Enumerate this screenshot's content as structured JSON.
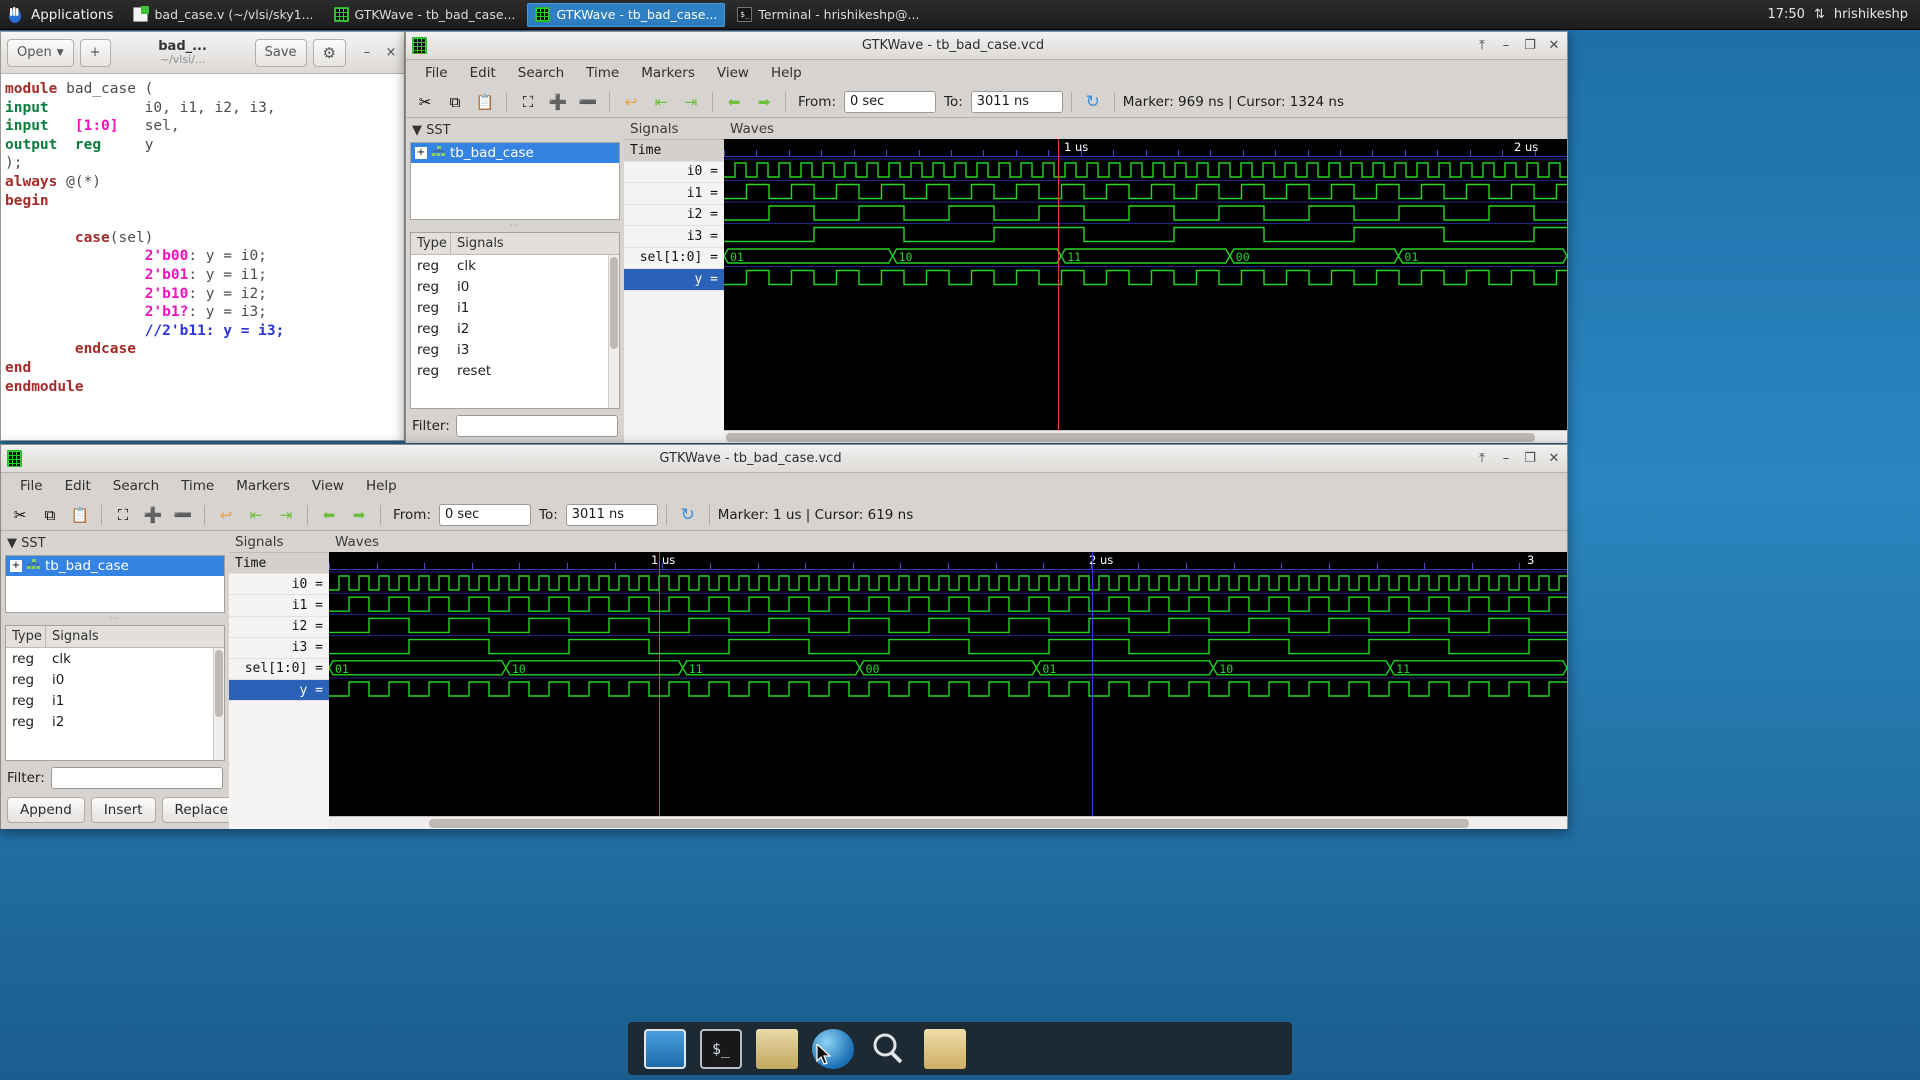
{
  "topbar": {
    "apps_label": "Applications",
    "tasks": [
      {
        "label": "bad_case.v (~/vlsi/sky1...",
        "icon": "gedit-icon",
        "active": false
      },
      {
        "label": "GTKWave - tb_bad_case...",
        "icon": "gtkwave-icon",
        "active": false
      },
      {
        "label": "GTKWave - tb_bad_case...",
        "icon": "gtkwave-icon",
        "active": true
      },
      {
        "label": "Terminal - hrishikeshp@...",
        "icon": "terminal-icon",
        "active": false
      }
    ],
    "clock": "17:50",
    "network_icon": "network-updown-icon",
    "user": "hrishikeshp"
  },
  "editor": {
    "open_label": "Open",
    "new_label": "+",
    "file_name": "bad_...",
    "file_path": "~/vlsi/...",
    "save_label": "Save",
    "menu_icon": "gear-icon",
    "minimize_label": "–",
    "close_label": "×",
    "code_lines": [
      [
        {
          "t": "module ",
          "c": "kw"
        },
        {
          "t": "bad_case (",
          "c": "pln"
        }
      ],
      [
        {
          "t": "input",
          "c": "kw2"
        },
        {
          "t": "           i0, i1, i2, i3,",
          "c": "pln"
        }
      ],
      [
        {
          "t": "input",
          "c": "kw2"
        },
        {
          "t": "   ",
          "c": "pln"
        },
        {
          "t": "[1:0]",
          "c": "lit"
        },
        {
          "t": "   sel,",
          "c": "pln"
        }
      ],
      [
        {
          "t": "output",
          "c": "kw2"
        },
        {
          "t": "  ",
          "c": "pln"
        },
        {
          "t": "reg",
          "c": "kw2"
        },
        {
          "t": "     y",
          "c": "pln"
        }
      ],
      [
        {
          "t": ");",
          "c": "pln"
        }
      ],
      [
        {
          "t": "always",
          "c": "kw"
        },
        {
          "t": " @(*)",
          "c": "pln"
        }
      ],
      [
        {
          "t": "begin",
          "c": "kw"
        }
      ],
      [
        {
          "t": "",
          "c": "pln"
        }
      ],
      [
        {
          "t": "        ",
          "c": "pln"
        },
        {
          "t": "case",
          "c": "kw"
        },
        {
          "t": "(sel)",
          "c": "pln"
        }
      ],
      [
        {
          "t": "                ",
          "c": "pln"
        },
        {
          "t": "2'b00",
          "c": "lit"
        },
        {
          "t": ": y = i0;",
          "c": "pln"
        }
      ],
      [
        {
          "t": "                ",
          "c": "pln"
        },
        {
          "t": "2'b01",
          "c": "lit"
        },
        {
          "t": ": y = i1;",
          "c": "pln"
        }
      ],
      [
        {
          "t": "                ",
          "c": "pln"
        },
        {
          "t": "2'b10",
          "c": "lit"
        },
        {
          "t": ": y = i2;",
          "c": "pln"
        }
      ],
      [
        {
          "t": "                ",
          "c": "pln"
        },
        {
          "t": "2'b1?",
          "c": "lit"
        },
        {
          "t": ": y = i3;",
          "c": "pln"
        }
      ],
      [
        {
          "t": "                ",
          "c": "pln"
        },
        {
          "t": "//2'b11: y = i3;",
          "c": "cmt"
        }
      ],
      [
        {
          "t": "        ",
          "c": "pln"
        },
        {
          "t": "endcase",
          "c": "kw"
        }
      ],
      [
        {
          "t": "end",
          "c": "kw"
        }
      ],
      [
        {
          "t": "endmodule",
          "c": "kw"
        }
      ]
    ]
  },
  "gtkwave_top": {
    "title": "GTKWave - tb_bad_case.vcd",
    "app_icon": "gtkwave-icon",
    "window_buttons": {
      "restore": "⤒",
      "minimize": "–",
      "maximize": "❐",
      "close": "✕"
    },
    "menu": [
      "File",
      "Edit",
      "Search",
      "Time",
      "Markers",
      "View",
      "Help"
    ],
    "toolbar_icons": [
      "cut-icon",
      "copy-icon",
      "paste-icon",
      "zoom-fit-icon",
      "zoom-in-icon",
      "zoom-out-icon",
      "undo-icon",
      "goto-start-icon",
      "goto-end-icon",
      "back-icon",
      "forward-icon"
    ],
    "from_label": "From:",
    "from_value": "0 sec",
    "to_label": "To:",
    "to_value": "3011 ns",
    "reload_icon": "reload-icon",
    "status": "Marker: 969 ns  |  Cursor: 1324 ns",
    "sst_label": "SST",
    "tree_root": "tb_bad_case",
    "signals_header": {
      "type": "Type",
      "signals": "Signals"
    },
    "signal_rows": [
      {
        "type": "reg",
        "name": "clk"
      },
      {
        "type": "reg",
        "name": "i0"
      },
      {
        "type": "reg",
        "name": "i1"
      },
      {
        "type": "reg",
        "name": "i2"
      },
      {
        "type": "reg",
        "name": "i3"
      },
      {
        "type": "reg",
        "name": "reset"
      }
    ],
    "filter_label": "Filter:",
    "filter_value": "",
    "signals_caption": "Signals",
    "waves_caption": "Waves",
    "time_label": "Time",
    "wave_names": [
      "i0 =",
      "i1 =",
      "i2 =",
      "i3 =",
      "sel[1:0] =",
      "y ="
    ],
    "selected_wave": "y =",
    "ruler_labels": [
      "1 us",
      "2 us"
    ],
    "sel_bus_values": [
      "01",
      "10",
      "11",
      "00",
      "01"
    ]
  },
  "gtkwave_bottom": {
    "title": "GTKWave - tb_bad_case.vcd",
    "app_icon": "gtkwave-icon",
    "window_buttons": {
      "restore": "⤒",
      "minimize": "–",
      "maximize": "❐",
      "close": "✕"
    },
    "menu": [
      "File",
      "Edit",
      "Search",
      "Time",
      "Markers",
      "View",
      "Help"
    ],
    "toolbar_icons": [
      "cut-icon",
      "copy-icon",
      "paste-icon",
      "zoom-fit-icon",
      "zoom-in-icon",
      "zoom-out-icon",
      "undo-icon",
      "goto-start-icon",
      "goto-end-icon",
      "back-icon",
      "forward-icon"
    ],
    "from_label": "From:",
    "from_value": "0 sec",
    "to_label": "To:",
    "to_value": "3011 ns",
    "reload_icon": "reload-icon",
    "status": "Marker: 1 us  |  Cursor: 619 ns",
    "sst_label": "SST",
    "tree_root": "tb_bad_case",
    "signals_header": {
      "type": "Type",
      "signals": "Signals"
    },
    "signal_rows": [
      {
        "type": "reg",
        "name": "clk"
      },
      {
        "type": "reg",
        "name": "i0"
      },
      {
        "type": "reg",
        "name": "i1"
      },
      {
        "type": "reg",
        "name": "i2"
      }
    ],
    "filter_label": "Filter:",
    "filter_value": "",
    "append_label": "Append",
    "insert_label": "Insert",
    "replace_label": "Replace",
    "signals_caption": "Signals",
    "waves_caption": "Waves",
    "time_label": "Time",
    "wave_names": [
      "i0 =",
      "i1 =",
      "i2 =",
      "i3 =",
      "sel[1:0] =",
      "y ="
    ],
    "selected_wave": "y =",
    "ruler_labels": [
      "1 us",
      "2 us",
      "3"
    ],
    "sel_bus_values": [
      "01",
      "10",
      "11",
      "00",
      "01",
      "10",
      "11"
    ]
  },
  "dock": {
    "items": [
      {
        "icon": "display-icon"
      },
      {
        "icon": "terminal-icon"
      },
      {
        "icon": "file-manager-icon"
      },
      {
        "icon": "web-browser-icon"
      },
      {
        "icon": "search-icon"
      },
      {
        "icon": "folder-icon"
      }
    ]
  },
  "colors": {
    "accent": "#3584e4",
    "wave_green": "#25d425",
    "marker_red": "#e03c3c",
    "marker_blue": "#3a3acb",
    "taskbar_active": "#2f7fc4"
  }
}
